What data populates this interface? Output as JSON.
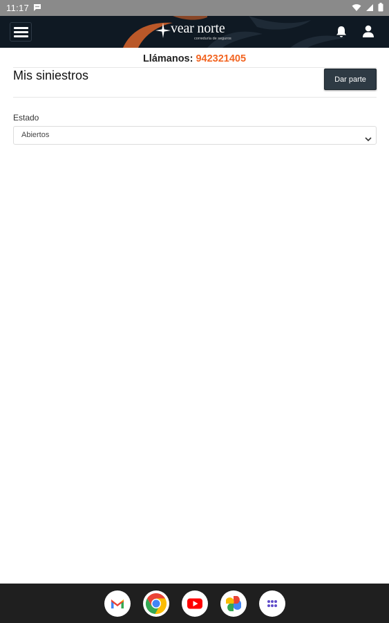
{
  "status_bar": {
    "time": "11:17",
    "icons": [
      "chat-notification-icon",
      "wifi-icon",
      "signal-icon",
      "battery-icon"
    ]
  },
  "header": {
    "brand_name": "vear norte",
    "brand_tagline": "correduría de seguros",
    "icons": [
      "menu-icon",
      "bell-icon",
      "user-icon"
    ],
    "colors": {
      "background": "#0f1923",
      "accent": "#f26522"
    }
  },
  "contact": {
    "label": "Llámanos:",
    "phone": "942321405"
  },
  "page": {
    "title": "Mis siniestros",
    "action_button": "Dar parte",
    "filter": {
      "label": "Estado",
      "selected": "Abiertos"
    }
  },
  "dock": {
    "apps": [
      "gmail-icon",
      "chrome-icon",
      "youtube-icon",
      "photos-icon",
      "app-drawer-icon"
    ]
  }
}
